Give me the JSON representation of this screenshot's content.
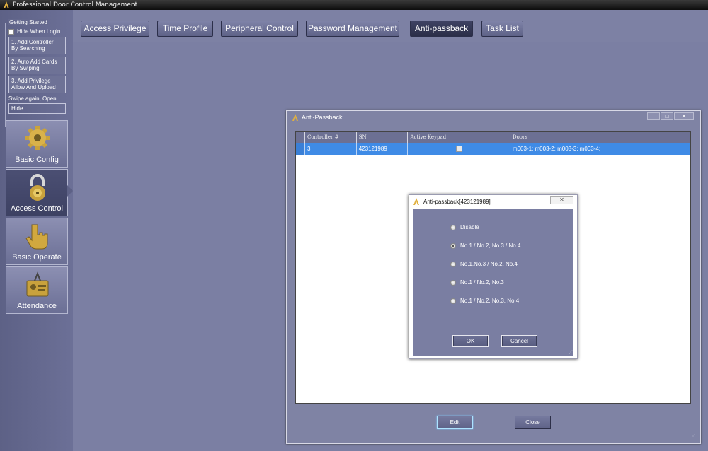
{
  "app": {
    "title": "Professional Door Control Management"
  },
  "getting_started": {
    "legend": "Getting Started",
    "hide_when_login": "Hide When Login",
    "steps": [
      {
        "line1": "1. Add Controller",
        "line2": "By Searching"
      },
      {
        "line1": "2. Auto Add Cards",
        "line2": "By Swiping"
      },
      {
        "line1": "3. Add Privilege",
        "line2": "Allow And Upload"
      }
    ],
    "swipe_again": "Swipe again, Open",
    "hide": "Hide"
  },
  "nav": [
    {
      "label": "Basic Config",
      "icon": "gear-icon"
    },
    {
      "label": "Access Control",
      "icon": "padlock-icon",
      "active": true
    },
    {
      "label": "Basic Operate",
      "icon": "hand-pointer-icon"
    },
    {
      "label": "Attendance",
      "icon": "attendance-card-icon"
    }
  ],
  "tabs": [
    {
      "label": "Access Privilege"
    },
    {
      "label": "Time Profile"
    },
    {
      "label": "Peripheral Control"
    },
    {
      "label": "Password Management"
    },
    {
      "label": "Anti-passback",
      "active": true
    },
    {
      "label": "Task List"
    }
  ],
  "window": {
    "title": "Anti-Passback",
    "controls": {
      "minimize": "_",
      "maximize": "□",
      "close": "✕"
    },
    "columns": [
      "Controller #",
      "SN",
      "Active Keypad",
      "Doors"
    ],
    "rows": [
      {
        "controller": "3",
        "sn": "423121989",
        "active_keypad": false,
        "doors": "m003-1;  m003-2;  m003-3;  m003-4;"
      }
    ],
    "edit": "Edit",
    "close": "Close"
  },
  "dialog": {
    "title": "Anti-passback[423121989]",
    "close": "✕",
    "options": [
      {
        "label": "Disable",
        "selected": false
      },
      {
        "label": "No.1 / No.2, No.3 / No.4",
        "selected": true
      },
      {
        "label": "No.1,No.3 / No.2, No.4",
        "selected": false
      },
      {
        "label": "No.1 / No.2, No.3",
        "selected": false
      },
      {
        "label": "No.1 / No.2, No.3, No.4",
        "selected": false
      }
    ],
    "ok": "OK",
    "cancel": "Cancel"
  },
  "colors": {
    "background": "#7b7fa3",
    "selection": "#3f8be6",
    "gold": "#c9a23c"
  }
}
